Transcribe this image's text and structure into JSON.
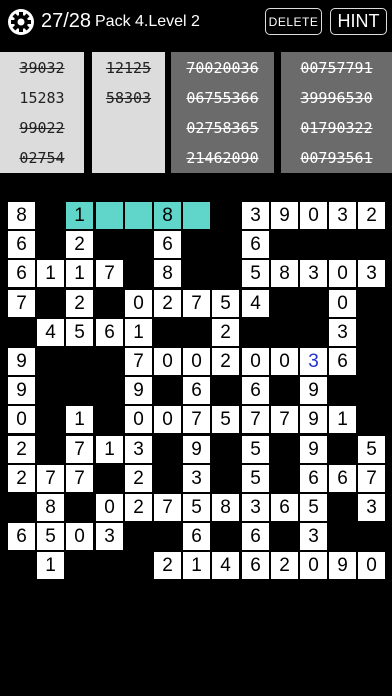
{
  "header": {
    "progress": "27/28",
    "pack_level": "Pack 4.Level 2",
    "delete_label": "DELETE",
    "hint_label": "HINT"
  },
  "clue_columns": [
    {
      "style": "light",
      "items": [
        {
          "text": "39032",
          "used": true
        },
        {
          "text": "15283",
          "used": false
        },
        {
          "text": "99022",
          "used": true
        },
        {
          "text": "02754",
          "used": true
        }
      ]
    },
    {
      "style": "light",
      "items": [
        {
          "text": "12125",
          "used": true
        },
        {
          "text": "58303",
          "used": true
        }
      ]
    },
    {
      "style": "dark",
      "items": [
        {
          "text": "70020036",
          "used": true
        },
        {
          "text": "06755366",
          "used": true
        },
        {
          "text": "02758365",
          "used": true
        },
        {
          "text": "21462090",
          "used": true
        }
      ]
    },
    {
      "style": "dark",
      "items": [
        {
          "text": "00757791",
          "used": true
        },
        {
          "text": "39996530",
          "used": true
        },
        {
          "text": "01790322",
          "used": true
        },
        {
          "text": "00793561",
          "used": true
        }
      ]
    }
  ],
  "grid": {
    "rows": 13,
    "cols": 13,
    "cells": [
      [
        0,
        0,
        "8"
      ],
      [
        0,
        2,
        "1"
      ],
      [
        0,
        3,
        ""
      ],
      [
        0,
        4,
        ""
      ],
      [
        0,
        5,
        "8"
      ],
      [
        0,
        6,
        ""
      ],
      [
        0,
        8,
        "3"
      ],
      [
        0,
        9,
        "9"
      ],
      [
        0,
        10,
        "0"
      ],
      [
        0,
        11,
        "3"
      ],
      [
        0,
        12,
        "2"
      ],
      [
        1,
        0,
        "6"
      ],
      [
        1,
        2,
        "2"
      ],
      [
        1,
        5,
        "6"
      ],
      [
        1,
        8,
        "6"
      ],
      [
        2,
        0,
        "6"
      ],
      [
        2,
        1,
        "1"
      ],
      [
        2,
        2,
        "1"
      ],
      [
        2,
        3,
        "7"
      ],
      [
        2,
        5,
        "8"
      ],
      [
        2,
        8,
        "5"
      ],
      [
        2,
        9,
        "8"
      ],
      [
        2,
        10,
        "3"
      ],
      [
        2,
        11,
        "0"
      ],
      [
        2,
        12,
        "3"
      ],
      [
        3,
        0,
        "7"
      ],
      [
        3,
        2,
        "2"
      ],
      [
        3,
        4,
        "0"
      ],
      [
        3,
        5,
        "2"
      ],
      [
        3,
        6,
        "7"
      ],
      [
        3,
        7,
        "5"
      ],
      [
        3,
        8,
        "4"
      ],
      [
        3,
        11,
        "0"
      ],
      [
        4,
        1,
        "4"
      ],
      [
        4,
        2,
        "5"
      ],
      [
        4,
        3,
        "6"
      ],
      [
        4,
        4,
        "1"
      ],
      [
        4,
        7,
        "2"
      ],
      [
        4,
        11,
        "3"
      ],
      [
        5,
        0,
        "9"
      ],
      [
        5,
        4,
        "7"
      ],
      [
        5,
        5,
        "0"
      ],
      [
        5,
        6,
        "0"
      ],
      [
        5,
        7,
        "2"
      ],
      [
        5,
        8,
        "0"
      ],
      [
        5,
        9,
        "0"
      ],
      [
        5,
        10,
        "3"
      ],
      [
        5,
        11,
        "6"
      ],
      [
        6,
        0,
        "9"
      ],
      [
        6,
        4,
        "9"
      ],
      [
        6,
        6,
        "6"
      ],
      [
        6,
        8,
        "6"
      ],
      [
        6,
        10,
        "9"
      ],
      [
        7,
        0,
        "0"
      ],
      [
        7,
        2,
        "1"
      ],
      [
        7,
        4,
        "0"
      ],
      [
        7,
        5,
        "0"
      ],
      [
        7,
        6,
        "7"
      ],
      [
        7,
        7,
        "5"
      ],
      [
        7,
        8,
        "7"
      ],
      [
        7,
        9,
        "7"
      ],
      [
        7,
        10,
        "9"
      ],
      [
        7,
        11,
        "1"
      ],
      [
        8,
        0,
        "2"
      ],
      [
        8,
        2,
        "7"
      ],
      [
        8,
        3,
        "1"
      ],
      [
        8,
        4,
        "3"
      ],
      [
        8,
        6,
        "9"
      ],
      [
        8,
        8,
        "5"
      ],
      [
        8,
        10,
        "9"
      ],
      [
        8,
        12,
        "5"
      ],
      [
        9,
        0,
        "2"
      ],
      [
        9,
        1,
        "7"
      ],
      [
        9,
        2,
        "7"
      ],
      [
        9,
        4,
        "2"
      ],
      [
        9,
        6,
        "3"
      ],
      [
        9,
        8,
        "5"
      ],
      [
        9,
        10,
        "6"
      ],
      [
        9,
        11,
        "6"
      ],
      [
        9,
        12,
        "7"
      ],
      [
        10,
        1,
        "8"
      ],
      [
        10,
        3,
        "0"
      ],
      [
        10,
        4,
        "2"
      ],
      [
        10,
        5,
        "7"
      ],
      [
        10,
        6,
        "5"
      ],
      [
        10,
        7,
        "8"
      ],
      [
        10,
        8,
        "3"
      ],
      [
        10,
        9,
        "6"
      ],
      [
        10,
        10,
        "5"
      ],
      [
        10,
        12,
        "3"
      ],
      [
        11,
        0,
        "6"
      ],
      [
        11,
        1,
        "5"
      ],
      [
        11,
        2,
        "0"
      ],
      [
        11,
        3,
        "3"
      ],
      [
        11,
        6,
        "6"
      ],
      [
        11,
        8,
        "6"
      ],
      [
        11,
        10,
        "3"
      ],
      [
        12,
        1,
        "1"
      ],
      [
        12,
        5,
        "2"
      ],
      [
        12,
        6,
        "1"
      ],
      [
        12,
        7,
        "4"
      ],
      [
        12,
        8,
        "6"
      ],
      [
        12,
        9,
        "2"
      ],
      [
        12,
        10,
        "0"
      ],
      [
        12,
        11,
        "9"
      ],
      [
        12,
        12,
        "0"
      ]
    ],
    "highlighted": [
      [
        0,
        2
      ],
      [
        0,
        3
      ],
      [
        0,
        4
      ],
      [
        0,
        5
      ],
      [
        0,
        6
      ]
    ],
    "blue_digits": [
      [
        5,
        10
      ]
    ]
  },
  "colors": {
    "background": "#000000",
    "highlight": "#5fd6c9",
    "cell": "#ffffff",
    "blue_digit": "#2233cc",
    "clue_light": "#dcdcdc",
    "clue_dark": "#6b6b6b"
  },
  "icons": {
    "settings": "gear-icon"
  }
}
